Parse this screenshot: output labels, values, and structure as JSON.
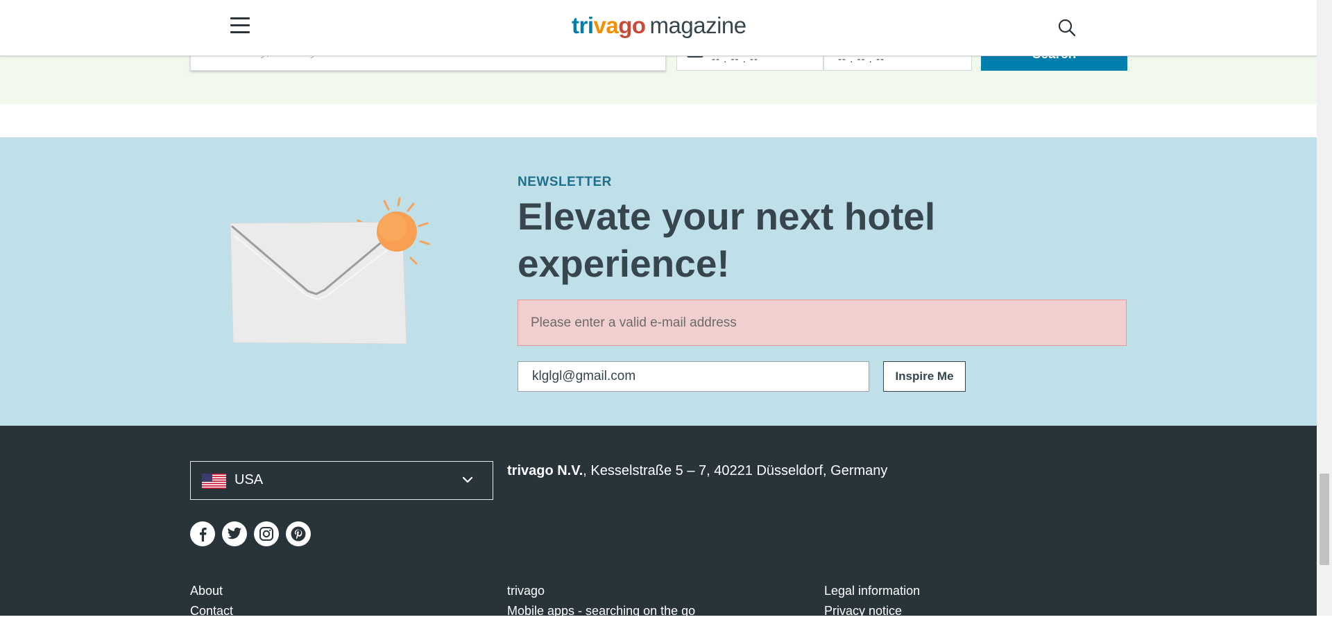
{
  "header": {
    "logo_part1": "tri",
    "logo_part2": "va",
    "logo_part3": "go",
    "logo_magazine": "magazine"
  },
  "search_bar": {
    "placeholder": "Search city, country or amenities",
    "checkin_value": "-- . -- . --",
    "checkout_value": "-- . -- . --",
    "button_label": "Search"
  },
  "newsletter": {
    "kicker": "NEWSLETTER",
    "title": "Elevate your next hotel experience!",
    "error_message": "Please enter a valid e-mail address",
    "email_value": "klglgl@gmail.com",
    "submit_label": "Inspire Me"
  },
  "footer": {
    "country": "USA",
    "company_name": "trivago N.V.",
    "address": ", Kesselstraße 5 – 7, 40221 Düsseldorf, Germany",
    "social": [
      "facebook-icon",
      "twitter-icon",
      "instagram-icon",
      "pinterest-icon"
    ],
    "links_col1": [
      "About",
      "Contact"
    ],
    "links_col2": [
      "trivago",
      "Mobile apps - searching on the go"
    ],
    "links_col3": [
      "Legal information",
      "Privacy notice"
    ]
  },
  "colors": {
    "brand_blue": "#007fad",
    "brand_orange": "#f48f00",
    "brand_red": "#c94a38",
    "newsletter_bg": "#bfdfe9",
    "footer_bg": "#29333a",
    "error_bg": "#f1cfce"
  }
}
